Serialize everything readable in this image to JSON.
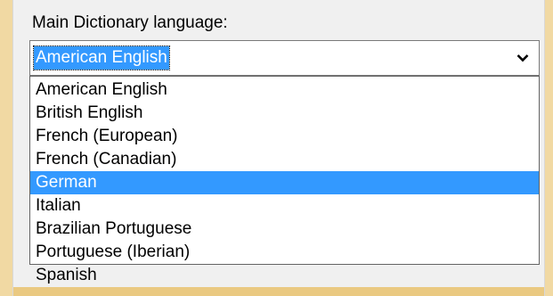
{
  "dictionary": {
    "label": "Main Dictionary language:",
    "selected_value": "American English",
    "highlighted_option": "German",
    "options": [
      "American English",
      "British English",
      "French (European)",
      "French (Canadian)",
      "German",
      "Italian",
      "Brazilian Portuguese",
      "Portuguese (Iberian)",
      "Spanish"
    ],
    "dropdown_icon": "chevron-down-icon"
  },
  "colors": {
    "selection": "#3399ff",
    "background": "#f0f0f0",
    "window_frame": "#f1d9a3"
  }
}
